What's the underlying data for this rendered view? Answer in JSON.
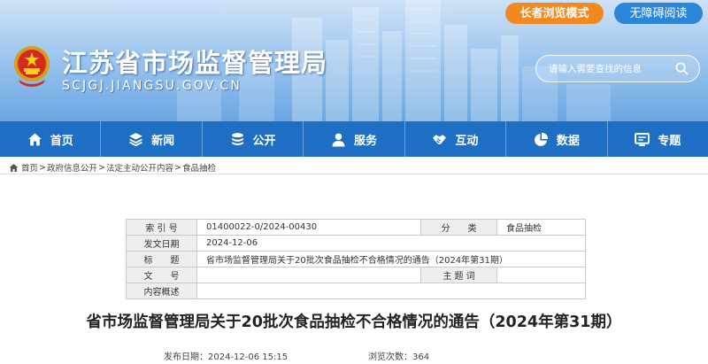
{
  "header": {
    "site_title": "江苏省市场监督管理局",
    "site_domain": "SCJGJ.JIANGSU.GOV.CN",
    "elder_mode": "长者浏览模式",
    "accessible_mode": "无障碍阅读",
    "search": {
      "placeholder": "请输入需要查找的信息"
    }
  },
  "nav": {
    "items": [
      {
        "label": "首页",
        "icon": "home-icon"
      },
      {
        "label": "新闻",
        "icon": "layers-icon"
      },
      {
        "label": "公开",
        "icon": "stack-icon"
      },
      {
        "label": "服务",
        "icon": "user-icon"
      },
      {
        "label": "互动",
        "icon": "handshake-icon"
      },
      {
        "label": "数据",
        "icon": "pie-chart-icon"
      },
      {
        "label": "专题",
        "icon": "monitor-icon"
      }
    ]
  },
  "breadcrumb": [
    "首页",
    "政府信息公开",
    "法定主动公开内容",
    "食品抽检"
  ],
  "info": {
    "index_label": "索 引 号",
    "index_value": "01400022-0/2024-00430",
    "category_label": "分　　类",
    "category_value": "食品抽检",
    "date_label": "发文日期",
    "date_value": "2024-12-06",
    "title_label": "标　　题",
    "title_value": "省市场监督管理局关于20批次食品抽检不合格情况的通告（2024年第31期）",
    "docno_label": "文　　号",
    "docno_value": "",
    "keywords_label": "主 题 词",
    "keywords_value": "",
    "summary_label": "内容概述",
    "summary_value": ""
  },
  "article": {
    "title": "省市场监督管理局关于20批次食品抽检不合格情况的通告（2024年第31期）",
    "publish_label": "发布日期：",
    "publish_value": "2024-12-06 15:15",
    "views_label": "浏览次数：",
    "views_value": "364"
  },
  "colors": {
    "nav_bg": "#1e6fc4",
    "elder_btn": "#f08a1f",
    "access_btn": "#2b86d9"
  }
}
